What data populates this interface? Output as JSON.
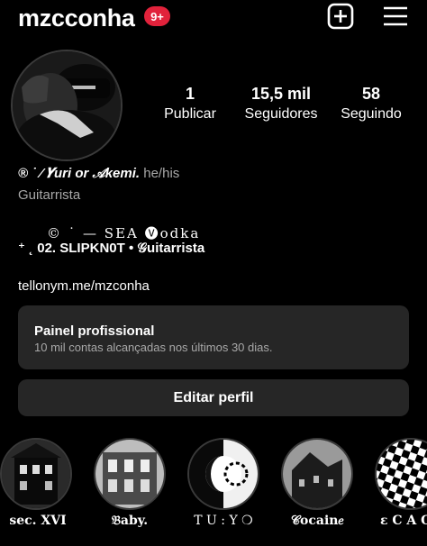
{
  "header": {
    "username": "mzcconha",
    "notification_badge": "9+",
    "badge_color": "#e1223b",
    "add_icon": "plus-square-icon",
    "menu_icon": "hamburger-menu-icon"
  },
  "stats": {
    "posts": {
      "value": "1",
      "label": "Publicar"
    },
    "followers": {
      "value": "15,5 mil",
      "label": "Seguidores"
    },
    "following": {
      "value": "58",
      "label": "Seguindo"
    }
  },
  "bio": {
    "line1": "® ˙ ⁄ 𝒀uri or 𝒜kemi.",
    "pronouns": "he/his",
    "category": "Guitarrista",
    "line2": "© ˙ — SEA 🅥odka",
    "line3": "⁺ ˛ 02. SLIPKN0T • 𝒢uitarrista",
    "link": "tellonym.me/mzconha"
  },
  "panel": {
    "title": "Painel profissional",
    "subtitle": "10 mil contas alcançadas nos últimos 30 dias."
  },
  "edit_button": "Editar perfil",
  "highlights": [
    {
      "label": "sec. XVI"
    },
    {
      "label": "𝔅aby."
    },
    {
      "label": "T U : Y ❍"
    },
    {
      "label": "𝒞ocain𝑒"
    },
    {
      "label": "ε C A O"
    }
  ]
}
